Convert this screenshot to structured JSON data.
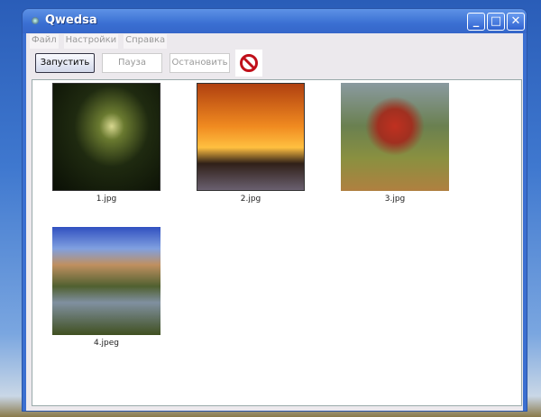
{
  "window": {
    "title": "Qwedsa"
  },
  "menu": [
    "Файл",
    "Настройки",
    "Справка"
  ],
  "toolbar": {
    "start": "Запустить",
    "pause": "Пауза",
    "stop": "Остановить"
  },
  "images": [
    {
      "name": "1.jpg"
    },
    {
      "name": "2.jpg"
    },
    {
      "name": "3.jpg"
    },
    {
      "name": "4.jpeg"
    }
  ]
}
